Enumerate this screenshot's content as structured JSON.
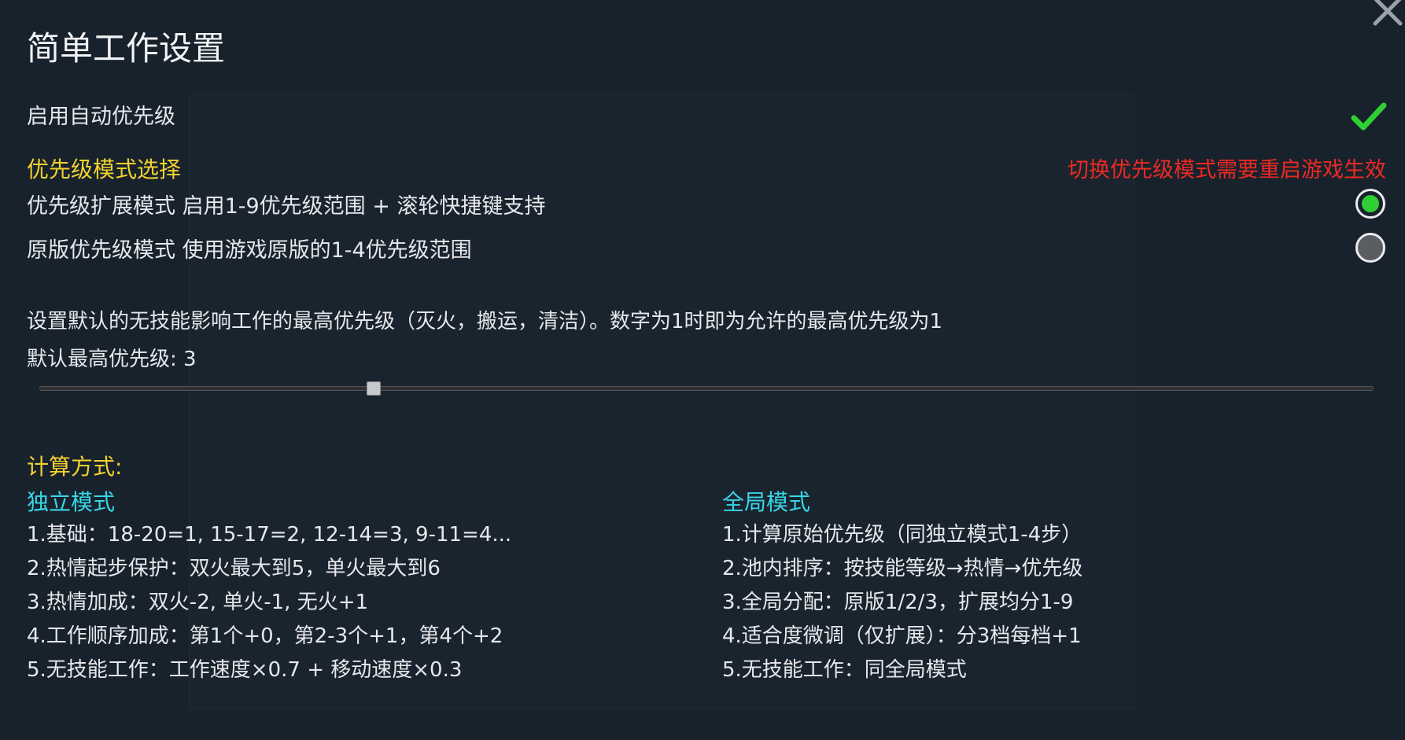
{
  "title": "简单工作设置",
  "auto_priority": {
    "label": "启用自动优先级",
    "enabled": true
  },
  "priority_mode": {
    "section_label": "优先级模式选择",
    "warning": "切换优先级模式需要重启游戏生效",
    "options": [
      {
        "label": "优先级扩展模式  启用1-9优先级范围 + 滚轮快捷键支持",
        "selected": true
      },
      {
        "label": "原版优先级模式  使用游戏原版的1-4优先级范围",
        "selected": false
      }
    ]
  },
  "default_priority": {
    "description": "设置默认的无技能影响工作的最高优先级（灭火，搬运，清洁）。数字为1时即为允许的最高优先级为1",
    "label": "默认最高优先级: 3",
    "value": 3,
    "min": 1,
    "max": 9
  },
  "calculation": {
    "section_label": "计算方式:",
    "independent": {
      "title": "独立模式",
      "items": [
        "1.基础：18-20=1, 15-17=2, 12-14=3, 9-11=4...",
        "2.热情起步保护：双火最大到5，单火最大到6",
        "3.热情加成：双火-2, 单火-1, 无火+1",
        "4.工作顺序加成：第1个+0，第2-3个+1，第4个+2",
        "5.无技能工作：工作速度×0.7 + 移动速度×0.3"
      ]
    },
    "global": {
      "title": "全局模式",
      "items": [
        "1.计算原始优先级（同独立模式1-4步）",
        "2.池内排序：按技能等级→热情→优先级",
        "3.全局分配：原版1/2/3，扩展均分1-9",
        "4.适合度微调（仅扩展）：分3档每档+1",
        "5.无技能工作：同全局模式"
      ]
    }
  },
  "colors": {
    "background": "#18222d",
    "heading_yellow": "#f2d22e",
    "heading_cyan": "#38d6e6",
    "warning_red": "#ec2a22",
    "check_green": "#2fd033"
  }
}
